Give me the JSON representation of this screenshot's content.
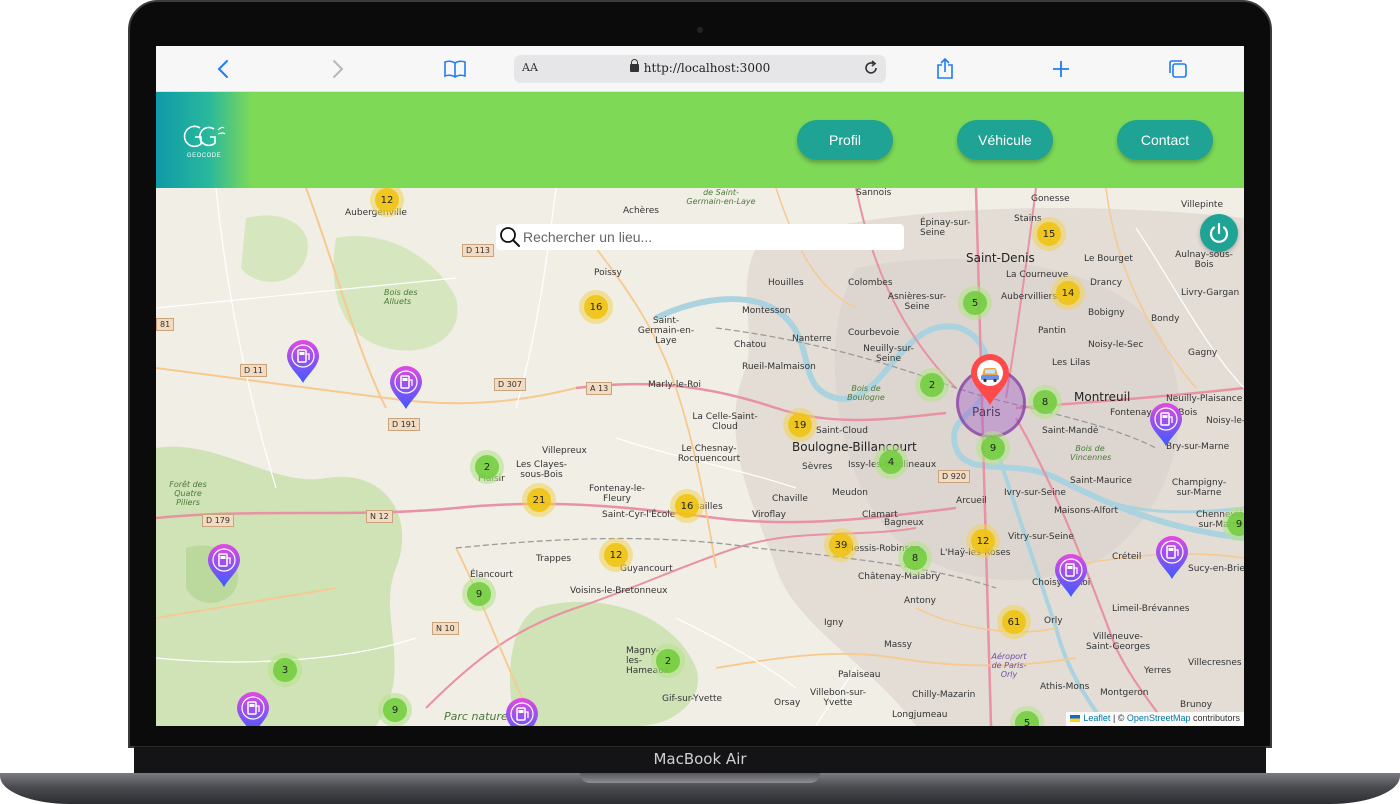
{
  "device": {
    "label": "MacBook Air"
  },
  "browser": {
    "text_size_label": "AA",
    "url": "http://localhost:3000"
  },
  "app": {
    "logo_text": "GEOCODE",
    "nav": [
      {
        "label": "Profil"
      },
      {
        "label": "Véhicule"
      },
      {
        "label": "Contact"
      }
    ]
  },
  "search": {
    "placeholder": "Rechercher un lieu..."
  },
  "map": {
    "labels": [
      "Aubergenville",
      "Achères",
      "de Saint-Germain-en-Laye",
      "Sannois",
      "Épinay-sur-Seine",
      "Stains",
      "Gonesse",
      "Villepinte",
      "Saint-Denis",
      "Le Bourget",
      "Aulnay-sous-Bois",
      "Poissy",
      "Houilles",
      "Colombes",
      "La Courneuve",
      "Drancy",
      "Livry-Gargan",
      "Bois des Alluets",
      "Montesson",
      "Asnières-sur-Seine",
      "Aubervilliers",
      "Bobigny",
      "Bondy",
      "Saint-Germain-en-Laye",
      "Chatou",
      "Nanterre",
      "Courbevoie",
      "Neuilly-sur-Seine",
      "Pantin",
      "Noisy-le-Sec",
      "Gagny",
      "Rueil-Malmaison",
      "Les Lilas",
      "Marly-le-Roi",
      "Bois de Boulogne",
      "Paris",
      "Montreuil",
      "Neuilly-Plaisance",
      "Fontenay-sous-Bois",
      "La Celle-Saint-Cloud",
      "Saint-Cloud",
      "Saint-Mandé",
      "Noisy-le-",
      "Bry-sur-Marne",
      "Villepreux",
      "Le Chesnay-Rocquencourt",
      "Boulogne-Billancourt",
      "Bois de Vincennes",
      "Les Clayes-sous-Bois",
      "Plaisir",
      "Sèvres",
      "Issy-les-Moulineaux",
      "Saint-Maurice",
      "Champigny-sur-Marne",
      "Forêt des Quatre Piliers",
      "Fontenay-le-Fleury",
      "Versailles",
      "Chaville",
      "Meudon",
      "Ivry-sur-Seine",
      "Saint-Cyr-l'École",
      "Viroflay",
      "Clamart",
      "Arcueil",
      "Maisons-Alfort",
      "Chennevières-sur-Marne",
      "Bagneux",
      "Vitry-sur-Seine",
      "Trappes",
      "Guyancourt",
      "Plessis-Robinson",
      "L'Haÿ-les-Roses",
      "Créteil",
      "Sucy-en-Brie",
      "Élancourt",
      "Châtenay-Malabry",
      "Choisy-le-Roi",
      "Voisins-le-Bretonneux",
      "Antony",
      "Limeil-Brévannes",
      "Igny",
      "Orly",
      "Villeneuve-Saint-Georges",
      "Massy",
      "Aéroport de Paris-Orly",
      "Villecresnes",
      "Magny-les-Hameaux",
      "Palaiseau",
      "Athis-Mons",
      "Yerres",
      "Gif-sur-Yvette",
      "Orsay",
      "Villebon-sur-Yvette",
      "Chilly-Mazarin",
      "Montgeron",
      "Brunoy",
      "Longjumeau",
      "Parc naturel"
    ],
    "roads": [
      "D 113",
      "D 11",
      "D 307",
      "A 13",
      "D 191",
      "N 12",
      "D 179",
      "N 10",
      "D 920",
      "81"
    ],
    "clusters": [
      {
        "count": "12",
        "color": "yellow"
      },
      {
        "count": "15",
        "color": "yellow"
      },
      {
        "count": "16",
        "color": "yellow"
      },
      {
        "count": "5",
        "color": "green"
      },
      {
        "count": "14",
        "color": "yellow"
      },
      {
        "count": "2",
        "color": "green"
      },
      {
        "count": "8",
        "color": "green"
      },
      {
        "count": "19",
        "color": "yellow"
      },
      {
        "count": "9",
        "color": "green"
      },
      {
        "count": "4",
        "color": "green"
      },
      {
        "count": "2",
        "color": "green"
      },
      {
        "count": "21",
        "color": "yellow"
      },
      {
        "count": "16",
        "color": "yellow"
      },
      {
        "count": "12",
        "color": "yellow"
      },
      {
        "count": "39",
        "color": "yellow"
      },
      {
        "count": "12",
        "color": "yellow"
      },
      {
        "count": "8",
        "color": "green"
      },
      {
        "count": "9",
        "color": "green"
      },
      {
        "count": "61",
        "color": "yellow"
      },
      {
        "count": "2",
        "color": "green"
      },
      {
        "count": "3",
        "color": "green"
      },
      {
        "count": "9",
        "color": "green"
      },
      {
        "count": "5",
        "color": "green"
      },
      {
        "count": "9",
        "color": "green"
      }
    ],
    "pin_colors": {
      "charging_top": "#e14ae0",
      "charging_bottom": "#3b5bff",
      "vehicle": "#ff4a4a"
    },
    "attribution": {
      "leaflet": "Leaflet",
      "separator": " | © ",
      "osm": "OpenStreetMap",
      "suffix": " contributors"
    }
  }
}
